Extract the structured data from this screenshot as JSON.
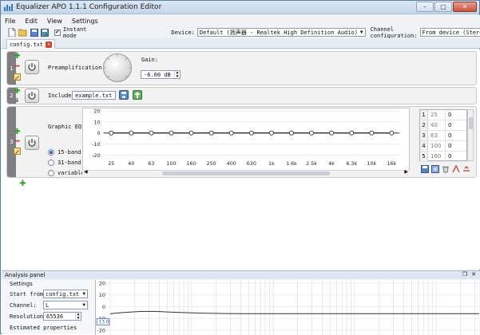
{
  "window": {
    "title": "Equalizer APO 1.1.1 Configuration Editor",
    "buttons": [
      "–",
      "□",
      "✕"
    ]
  },
  "menu": [
    "File",
    "Edit",
    "View",
    "Settings"
  ],
  "toolbar": {
    "instant_mode_label": "Instant mode",
    "instant_mode_checked": true,
    "device_label": "Device:",
    "device_value": "Default (扬声器 - Realtek High Definition Audio)",
    "channel_config_label": "Channel configuration:",
    "channel_config_value": "From device (Stereo)"
  },
  "tab": {
    "label": "config.txt"
  },
  "filters": {
    "f1": {
      "num": "1",
      "preamp_label": "Preamplification:",
      "gain_label": "Gain:",
      "gain_value": "-6.00 dB"
    },
    "f2": {
      "num": "2",
      "include_label": "Include:",
      "include_value": "example.txt"
    },
    "f3": {
      "num": "3",
      "label": "Graphic EQ:",
      "band_options": [
        "15-band",
        "31-band",
        "variable"
      ],
      "band_selected": "15-band",
      "y_ticks": [
        "20",
        "10",
        "0",
        "-10",
        "-20"
      ],
      "x_ticks": [
        "25",
        "40",
        "63",
        "100",
        "160",
        "250",
        "400",
        "630",
        "1k",
        "1.6k",
        "2.5k",
        "4k",
        "6.3k",
        "10k",
        "16k"
      ],
      "table": [
        {
          "idx": "1",
          "freq": "25",
          "gain": "0"
        },
        {
          "idx": "2",
          "freq": "40",
          "gain": "0"
        },
        {
          "idx": "3",
          "freq": "63",
          "gain": "0"
        },
        {
          "idx": "4",
          "freq": "100",
          "gain": "0"
        },
        {
          "idx": "5",
          "freq": "160",
          "gain": "0"
        }
      ]
    }
  },
  "chart_data": {
    "type": "line",
    "categories": [
      "25",
      "40",
      "63",
      "100",
      "160",
      "250",
      "400",
      "630",
      "1k",
      "1.6k",
      "2.5k",
      "4k",
      "6.3k",
      "10k",
      "16k"
    ],
    "values": [
      0,
      0,
      0,
      0,
      0,
      0,
      0,
      0,
      0,
      0,
      0,
      0,
      0,
      0,
      0
    ],
    "ylim": [
      -20,
      20
    ],
    "y_ticks": [
      20,
      10,
      0,
      -10,
      -20
    ]
  },
  "analysis": {
    "title": "Analysis panel",
    "settings_label": "Settings",
    "start_from_label": "Start from:",
    "start_from_value": "config.txt",
    "channel_label": "Channel:",
    "channel_value": "L",
    "resolution_label": "Resolution:",
    "resolution_value": "65536",
    "estimated_label": "Estimated properties",
    "y_ticks": [
      "20",
      "10",
      "0",
      "-10",
      "-20"
    ],
    "cursor_value": "-13.0"
  },
  "colors": {
    "accent": "#2b5fa8",
    "plus": "#2e9d2e",
    "minus": "#d03a3a",
    "close": "#d04a32"
  }
}
